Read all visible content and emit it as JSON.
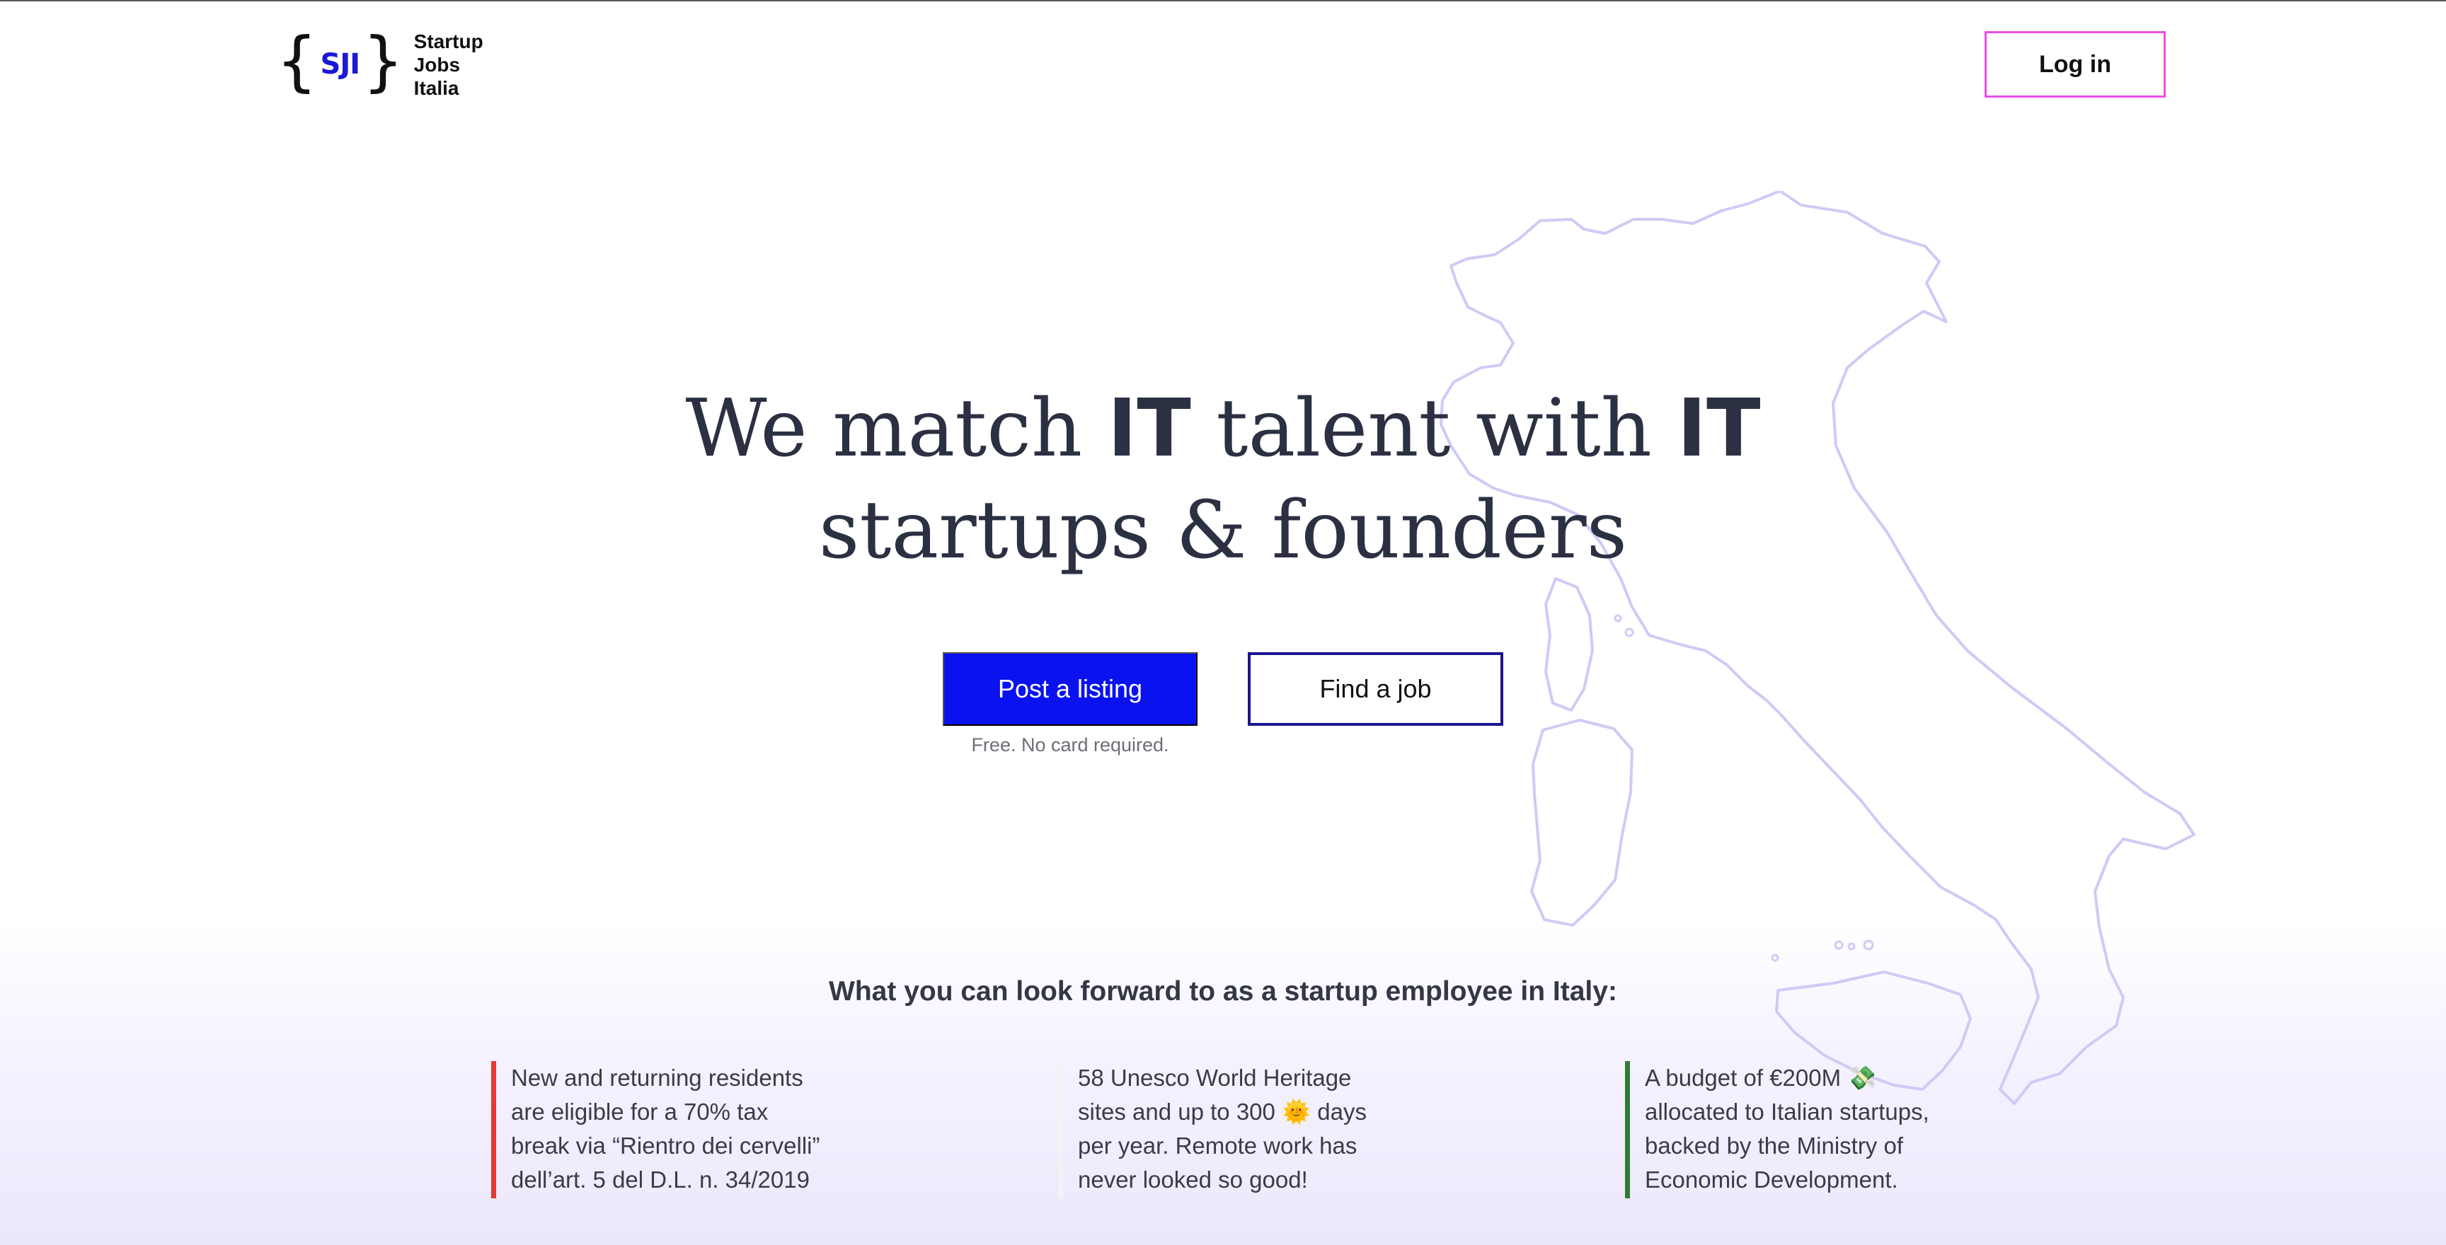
{
  "brand": {
    "initials": "SJI",
    "name_lines": [
      "Startup",
      "Jobs",
      "Italia"
    ]
  },
  "header": {
    "login_label": "Log in"
  },
  "hero": {
    "title_part1": "We match ",
    "title_it1": "IT",
    "title_part2": " talent with ",
    "title_it2": "IT",
    "title_line2": "startups & founders",
    "post_label": "Post a listing",
    "find_label": "Find a job",
    "note": "Free. No card required."
  },
  "benefits": {
    "title": "What you can look forward to as a startup employee in Italy:",
    "items": [
      {
        "text": "New and returning residents\nare eligible for a 70% tax\nbreak via “Rientro dei cervelli”\ndell’art. 5 del D.L. n. 34/2019",
        "color": "#e53935"
      },
      {
        "text": "58 Unesco World Heritage\nsites and up to 300 🌞 days\nper year. Remote work has\nnever looked so good!",
        "color": "#f3f3f3"
      },
      {
        "text": "A budget of €200M 💸\nallocated to Italian startups,\nbacked by the Ministry of\nEconomic Development.",
        "color": "#2e7d32"
      }
    ]
  },
  "colors": {
    "primary": "#0b12f0",
    "outline": "#1d138f",
    "login_border": "#e94ee8",
    "map_stroke": "#cfcaf6"
  }
}
